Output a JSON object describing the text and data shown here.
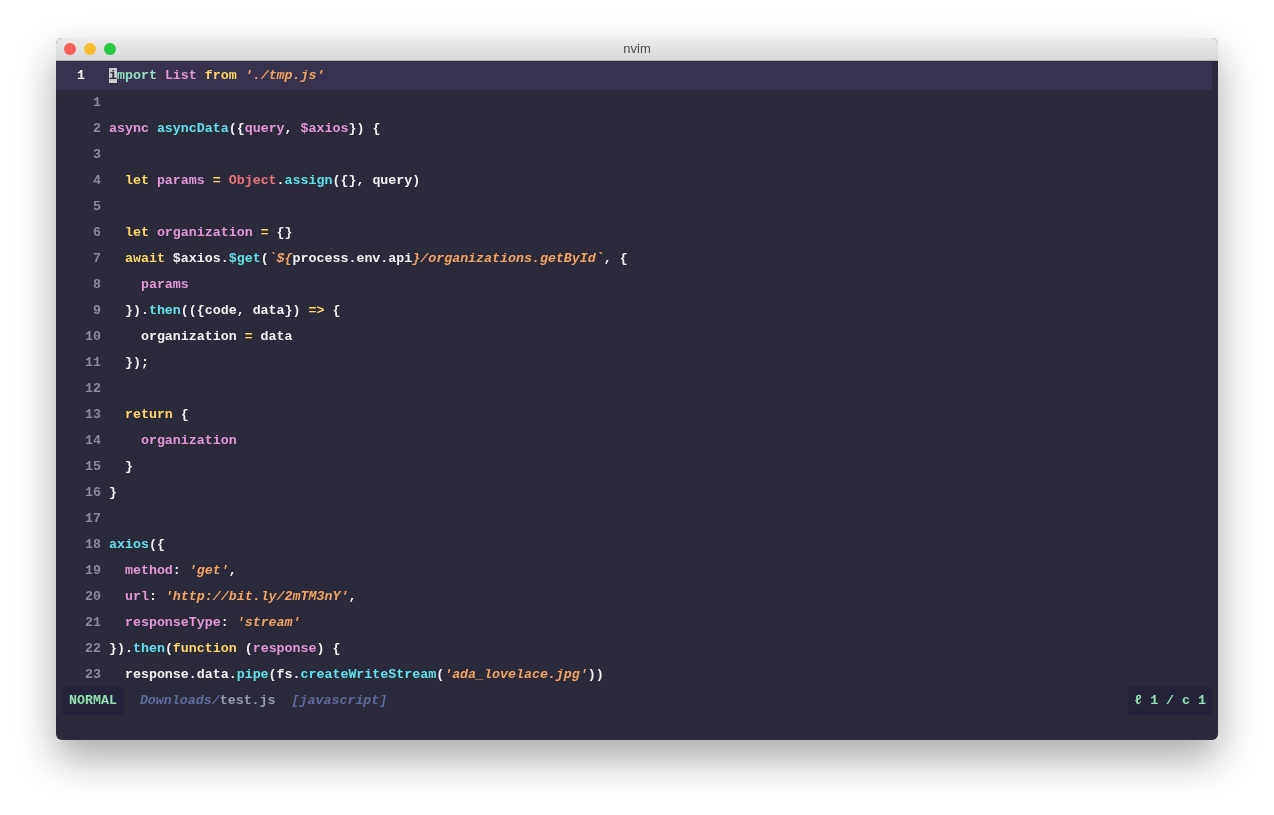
{
  "window": {
    "title": "nvim"
  },
  "lines": [
    {
      "number": "1",
      "current": true,
      "tokens": [
        {
          "kind": "cursor",
          "text": "i"
        },
        {
          "kind": "module",
          "text": "mport "
        },
        {
          "kind": "variable",
          "text": "List "
        },
        {
          "kind": "keyword",
          "text": "from "
        },
        {
          "kind": "string",
          "text": "'./tmp.js'"
        }
      ]
    },
    {
      "number": "1",
      "current": false
    },
    {
      "number": "2",
      "current": false,
      "tokens": [
        {
          "kind": "variable",
          "text": "async "
        },
        {
          "kind": "function",
          "text": "asyncData"
        },
        {
          "kind": "plain",
          "text": "({"
        },
        {
          "kind": "variable",
          "text": "query"
        },
        {
          "kind": "plain",
          "text": ", "
        },
        {
          "kind": "variable",
          "text": "$axios"
        },
        {
          "kind": "plain",
          "text": "}) {"
        }
      ]
    },
    {
      "number": "3",
      "current": false
    },
    {
      "number": "4",
      "current": false,
      "tokens": [
        {
          "kind": "keyword",
          "text": "  let "
        },
        {
          "kind": "variable",
          "text": "params "
        },
        {
          "kind": "keyword",
          "text": "= "
        },
        {
          "kind": "class",
          "text": "Object"
        },
        {
          "kind": "plain",
          "text": "."
        },
        {
          "kind": "function",
          "text": "assign"
        },
        {
          "kind": "plain",
          "text": "({}, query)"
        }
      ]
    },
    {
      "number": "5",
      "current": false
    },
    {
      "number": "6",
      "current": false,
      "tokens": [
        {
          "kind": "keyword",
          "text": "  let "
        },
        {
          "kind": "variable",
          "text": "organization "
        },
        {
          "kind": "keyword",
          "text": "="
        },
        {
          "kind": "plain",
          "text": " {}"
        }
      ]
    },
    {
      "number": "7",
      "current": false,
      "tokens": [
        {
          "kind": "keyword",
          "text": "  await"
        },
        {
          "kind": "plain",
          "text": " $axios."
        },
        {
          "kind": "function",
          "text": "$get"
        },
        {
          "kind": "plain",
          "text": "("
        },
        {
          "kind": "string",
          "text": "`${"
        },
        {
          "kind": "plain",
          "text": "process.env.api"
        },
        {
          "kind": "string",
          "text": "}/organizations.getById`"
        },
        {
          "kind": "plain",
          "text": ", {"
        }
      ]
    },
    {
      "number": "8",
      "current": false,
      "tokens": [
        {
          "kind": "variable",
          "text": "    params"
        }
      ]
    },
    {
      "number": "9",
      "current": false,
      "tokens": [
        {
          "kind": "plain",
          "text": "  })."
        },
        {
          "kind": "function",
          "text": "then"
        },
        {
          "kind": "plain",
          "text": "(({code, data}) "
        },
        {
          "kind": "keyword",
          "text": "=>"
        },
        {
          "kind": "plain",
          "text": " {"
        }
      ]
    },
    {
      "number": "10",
      "current": false,
      "tokens": [
        {
          "kind": "plain",
          "text": "    organization "
        },
        {
          "kind": "keyword",
          "text": "="
        },
        {
          "kind": "plain",
          "text": " data"
        }
      ]
    },
    {
      "number": "11",
      "current": false,
      "tokens": [
        {
          "kind": "plain",
          "text": "  });"
        }
      ]
    },
    {
      "number": "12",
      "current": false
    },
    {
      "number": "13",
      "current": false,
      "tokens": [
        {
          "kind": "keyword",
          "text": "  return"
        },
        {
          "kind": "plain",
          "text": " {"
        }
      ]
    },
    {
      "number": "14",
      "current": false,
      "tokens": [
        {
          "kind": "variable",
          "text": "    organization"
        }
      ]
    },
    {
      "number": "15",
      "current": false,
      "tokens": [
        {
          "kind": "plain",
          "text": "  }"
        }
      ]
    },
    {
      "number": "16",
      "current": false,
      "tokens": [
        {
          "kind": "plain",
          "text": "}"
        }
      ]
    },
    {
      "number": "17",
      "current": false
    },
    {
      "number": "18",
      "current": false,
      "tokens": [
        {
          "kind": "function",
          "text": "axios"
        },
        {
          "kind": "plain",
          "text": "({"
        }
      ]
    },
    {
      "number": "19",
      "current": false,
      "tokens": [
        {
          "kind": "variable",
          "text": "  method"
        },
        {
          "kind": "plain",
          "text": ": "
        },
        {
          "kind": "string",
          "text": "'get'"
        },
        {
          "kind": "plain",
          "text": ","
        }
      ]
    },
    {
      "number": "20",
      "current": false,
      "tokens": [
        {
          "kind": "variable",
          "text": "  url"
        },
        {
          "kind": "plain",
          "text": ": "
        },
        {
          "kind": "string",
          "text": "'http://bit.ly/2mTM3nY'"
        },
        {
          "kind": "plain",
          "text": ","
        }
      ]
    },
    {
      "number": "21",
      "current": false,
      "tokens": [
        {
          "kind": "variable",
          "text": "  responseType"
        },
        {
          "kind": "plain",
          "text": ": "
        },
        {
          "kind": "string",
          "text": "'stream'"
        }
      ]
    },
    {
      "number": "22",
      "current": false,
      "tokens": [
        {
          "kind": "plain",
          "text": "})."
        },
        {
          "kind": "function",
          "text": "then"
        },
        {
          "kind": "plain",
          "text": "("
        },
        {
          "kind": "keyword",
          "text": "function"
        },
        {
          "kind": "plain",
          "text": " ("
        },
        {
          "kind": "variable",
          "text": "response"
        },
        {
          "kind": "plain",
          "text": ") {"
        }
      ]
    },
    {
      "number": "23",
      "current": false,
      "tokens": [
        {
          "kind": "plain",
          "text": "  response.data."
        },
        {
          "kind": "function",
          "text": "pipe"
        },
        {
          "kind": "plain",
          "text": "(fs."
        },
        {
          "kind": "function",
          "text": "createWriteStream"
        },
        {
          "kind": "plain",
          "text": "("
        },
        {
          "kind": "string",
          "text": "'ada_lovelace.jpg'"
        },
        {
          "kind": "plain",
          "text": "))"
        }
      ]
    }
  ],
  "status_bar": {
    "mode": "NORMAL",
    "directory": "Downloads/",
    "file": "test.js",
    "filetype": "[javascript]",
    "position": "ℓ 1 / c 1"
  }
}
